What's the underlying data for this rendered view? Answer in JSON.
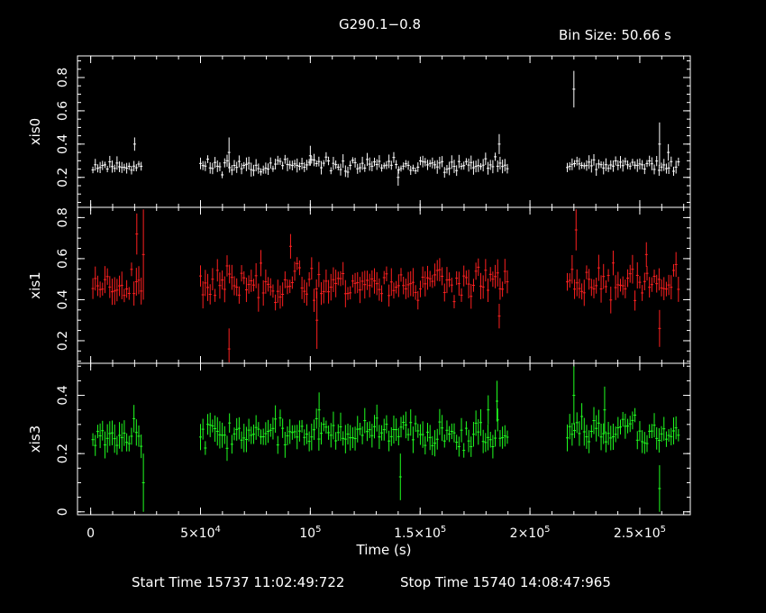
{
  "title": "G290.1−0.8",
  "bin_label": "Bin Size: 50.66 s",
  "footer": {
    "start_label": "Start Time 15737 11:02:49:722",
    "stop_label": "Stop Time 15740 14:08:47:965"
  },
  "chart_data": {
    "type": "scatter",
    "xlabel": "Time (s)",
    "xlim": [
      -6000,
      273000
    ],
    "x_ticks": [
      {
        "value": 0,
        "label": "0"
      },
      {
        "value": 50000,
        "label": "5×10",
        "sup": "4"
      },
      {
        "value": 100000,
        "label": "10",
        "sup": "5"
      },
      {
        "value": 150000,
        "label": "1.5×10",
        "sup": "5"
      },
      {
        "value": 200000,
        "label": "2×10",
        "sup": "5"
      },
      {
        "value": 250000,
        "label": "2.5×10",
        "sup": "5"
      }
    ],
    "segments": [
      [
        1000,
        24000
      ],
      [
        50000,
        190000
      ],
      [
        217000,
        268000
      ]
    ],
    "panels": [
      {
        "name": "xis0",
        "ylabel": "xis0",
        "color": "#ffffff",
        "ylim": [
          0.02,
          0.93
        ],
        "yticks": [
          0.2,
          0.4,
          0.6,
          0.8
        ],
        "ytick_labels": [
          "0.2",
          "0.4",
          "0.6",
          "0.8"
        ],
        "baseline": 0.27,
        "noise": 0.025,
        "err": 0.03,
        "seed": 11,
        "features": [
          {
            "x": 20000,
            "y": 0.4,
            "err": 0.04
          },
          {
            "x": 63000,
            "y": 0.35,
            "err": 0.09
          },
          {
            "x": 100000,
            "y": 0.33,
            "err": 0.06
          },
          {
            "x": 140000,
            "y": 0.2,
            "err": 0.05
          },
          {
            "x": 186000,
            "y": 0.4,
            "err": 0.06
          },
          {
            "x": 220000,
            "y": 0.73,
            "err": 0.11
          },
          {
            "x": 259000,
            "y": 0.4,
            "err": 0.13
          },
          {
            "x": 263000,
            "y": 0.35,
            "err": 0.05
          }
        ]
      },
      {
        "name": "xis1",
        "ylabel": "xis1",
        "color": "#ff2020",
        "ylim": [
          0.09,
          0.85
        ],
        "yticks": [
          0.2,
          0.4,
          0.6,
          0.8
        ],
        "ytick_labels": [
          "0.2",
          "0.4",
          "0.6",
          "0.8"
        ],
        "baseline": 0.48,
        "noise": 0.05,
        "err": 0.05,
        "seed": 23,
        "features": [
          {
            "x": 21000,
            "y": 0.72,
            "err": 0.1
          },
          {
            "x": 24000,
            "y": 0.62,
            "err": 0.22
          },
          {
            "x": 63000,
            "y": 0.16,
            "err": 0.1
          },
          {
            "x": 91000,
            "y": 0.66,
            "err": 0.06
          },
          {
            "x": 103000,
            "y": 0.3,
            "err": 0.14
          },
          {
            "x": 186000,
            "y": 0.32,
            "err": 0.06
          },
          {
            "x": 221000,
            "y": 0.74,
            "err": 0.1
          },
          {
            "x": 259000,
            "y": 0.26,
            "err": 0.09
          },
          {
            "x": 253000,
            "y": 0.62,
            "err": 0.06
          }
        ]
      },
      {
        "name": "xis3",
        "ylabel": "xis3",
        "color": "#20ff20",
        "ylim": [
          -0.01,
          0.51
        ],
        "yticks": [
          0,
          0.2,
          0.4
        ],
        "ytick_labels": [
          "0",
          "0.2",
          "0.4"
        ],
        "baseline": 0.27,
        "noise": 0.03,
        "err": 0.035,
        "seed": 37,
        "features": [
          {
            "x": 24000,
            "y": 0.1,
            "err": 0.1
          },
          {
            "x": 104000,
            "y": 0.35,
            "err": 0.06
          },
          {
            "x": 141000,
            "y": 0.12,
            "err": 0.08
          },
          {
            "x": 181000,
            "y": 0.35,
            "err": 0.05
          },
          {
            "x": 185000,
            "y": 0.38,
            "err": 0.07
          },
          {
            "x": 220000,
            "y": 0.4,
            "err": 0.1
          },
          {
            "x": 234000,
            "y": 0.35,
            "err": 0.08
          },
          {
            "x": 259000,
            "y": 0.08,
            "err": 0.08
          }
        ]
      }
    ]
  }
}
